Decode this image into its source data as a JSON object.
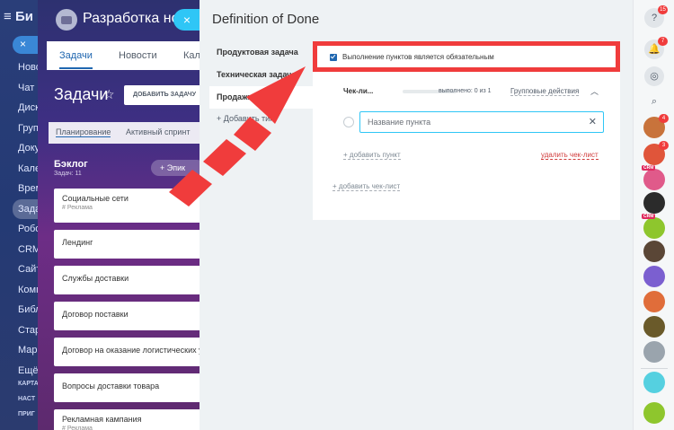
{
  "sidebar": {
    "brand": "Би",
    "search_icon": "x-icon",
    "items": [
      "Ново",
      "Чат",
      "Диск",
      "Груп",
      "Доку",
      "Кале",
      "Врем",
      "Зада",
      "Робо",
      "CRM",
      "Сайт",
      "Комп",
      "Библ",
      "Стар",
      "Мар",
      "Ещё"
    ],
    "active_index": 7,
    "footer": [
      "КАРТА",
      "НАСТ",
      "ПРИГ"
    ]
  },
  "project": {
    "title": "Разработка нов",
    "tabs": [
      "Задачи",
      "Новости",
      "Кал"
    ],
    "tasks_title": "Задачи",
    "add_task": "ДОБАВИТЬ ЗАДАЧУ",
    "filters": [
      "Планирование",
      "Активный спринт"
    ],
    "backlog": "Бэклог",
    "backlog_sub": "Задач: 11",
    "epic_button": "+ Эпик",
    "cards": [
      {
        "title": "Социальные сети",
        "sub": "# Реклама"
      },
      {
        "title": "Лендинг",
        "sub": ""
      },
      {
        "title": "Службы доставки",
        "sub": ""
      },
      {
        "title": "Договор поставки",
        "sub": ""
      },
      {
        "title": "Договор на оказание логистических усл",
        "sub": ""
      },
      {
        "title": "Вопросы доставки товара",
        "sub": ""
      },
      {
        "title": "Рекламная кампания",
        "sub": "# Реклама"
      }
    ]
  },
  "panel": {
    "title": "Definition of Done",
    "types": [
      "Продуктовая задача",
      "Техническая задача",
      "Продажи"
    ],
    "active_type_index": 2,
    "add_type": "+ Добавить тип",
    "required_label": "Выполнение пунктов является обязательным",
    "required_checked": true,
    "checklist": {
      "name": "Чек-ли...",
      "done": "выполнено: 0 из 1",
      "progress": 0,
      "group_actions": "Групповые действия",
      "item_placeholder": "Название пункта",
      "add_item": "+ добавить пункт",
      "delete_list": "удалить чек-лист"
    },
    "add_checklist": "+ добавить чек-лист"
  },
  "rail": {
    "badges": {
      "help": "15",
      "notify": "7",
      "avatar1": "4",
      "avatar2": "3"
    },
    "crm_label": "CRM",
    "colors": {
      "accent": "#2067b0",
      "highlight": "#f03c3c",
      "phone": "#55d0e0",
      "call": "#8ec62d"
    }
  }
}
